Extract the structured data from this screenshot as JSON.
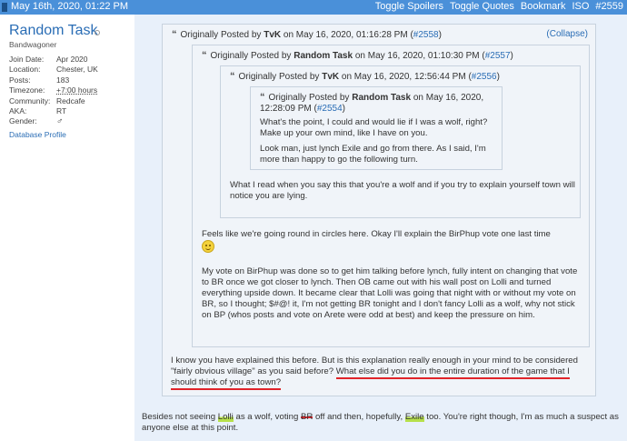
{
  "topbar": {
    "date": "May 16th, 2020, 01:22 PM",
    "toggle_spoilers": "Toggle Spoilers",
    "toggle_quotes": "Toggle Quotes",
    "bookmark": "Bookmark",
    "iso": "ISO",
    "post_number": "#2559"
  },
  "user": {
    "name": "Random Task",
    "title": "Bandwagoner",
    "join_label": "Join Date:",
    "join_value": "Apr 2020",
    "location_label": "Location:",
    "location_value": "Chester, UK",
    "posts_label": "Posts:",
    "posts_value": "183",
    "timezone_label": "Timezone:",
    "timezone_value": "+7:00 hours",
    "community_label": "Community:",
    "community_value": "Redcafe",
    "aka_label": "AKA:",
    "aka_value": "RT",
    "gender_label": "Gender:",
    "gender_value": "♂",
    "db_profile": "Database Profile"
  },
  "quotes": {
    "q1": {
      "prefix": "Originally Posted by",
      "author": "TvK",
      "date": "on May 16, 2020, 01:16:28 PM",
      "ref": "#2558",
      "collapse": "(Collapse)"
    },
    "q2": {
      "prefix": "Originally Posted by",
      "author": "Random Task",
      "date": "on May 16, 2020, 01:10:30 PM",
      "ref": "#2557"
    },
    "q3": {
      "prefix": "Originally Posted by",
      "author": "TvK",
      "date": "on May 16, 2020, 12:56:44 PM",
      "ref": "#2556"
    },
    "q4": {
      "prefix": "Originally Posted by",
      "author": "Random Task",
      "date": "on May 16, 2020,",
      "date2": "12:28:09 PM",
      "ref": "#2554"
    }
  },
  "text": {
    "q4_p1": "What's the point, I could and would lie if I was a wolf, right? Make up your own mind, like I have on you.",
    "q4_p2": "Look man, just lynch Exile and go from there. As I said, I'm more than happy to go the following turn.",
    "q3_p1": "What I read when you say this that you're a wolf and if you try to explain yourself town will notice you are lying.",
    "q2_p1": "Feels like we're going round in circles here. Okay I'll explain the BirPhup vote one last time",
    "q2_p2": "My vote on BirPhup was done so to get him talking before lynch, fully intent on changing that vote to BR once we got closer to lynch. Then OB came out with his wall post on Lolli and turned everything upside down. It became clear that Lolli was going that night with or without my vote on BR, so I thought; $#@! it, I'm not getting BR tonight and I don't fancy Lolli as a wolf, why not stick on BP (whos posts and vote on Arete were odd at best) and keep the pressure on him.",
    "q1_p1a": "I know you have explained this before. But is this explanation really enough in your mind to be considered \"fairly obvious village\" as you said before?",
    "q1_p1b": "What else did you do in the entire duration of the game that I should think of you as town?",
    "reply_a": "Besides not seeing ",
    "reply_lolli": "Lolli",
    "reply_b": " as a wolf, voting ",
    "reply_br": "BR",
    "reply_c": " off and then, hopefully, ",
    "reply_exile": "Exile",
    "reply_d": " too. You're right though, I'm as much a suspect as anyone else at this point."
  },
  "colors": {
    "topbar": "#4a90d9",
    "link": "#2a6db5",
    "underline": "#e0242a",
    "highlight": "#b6e04a",
    "post_bg": "#e8f0fa",
    "quote_bg": "#f0f4f9"
  }
}
